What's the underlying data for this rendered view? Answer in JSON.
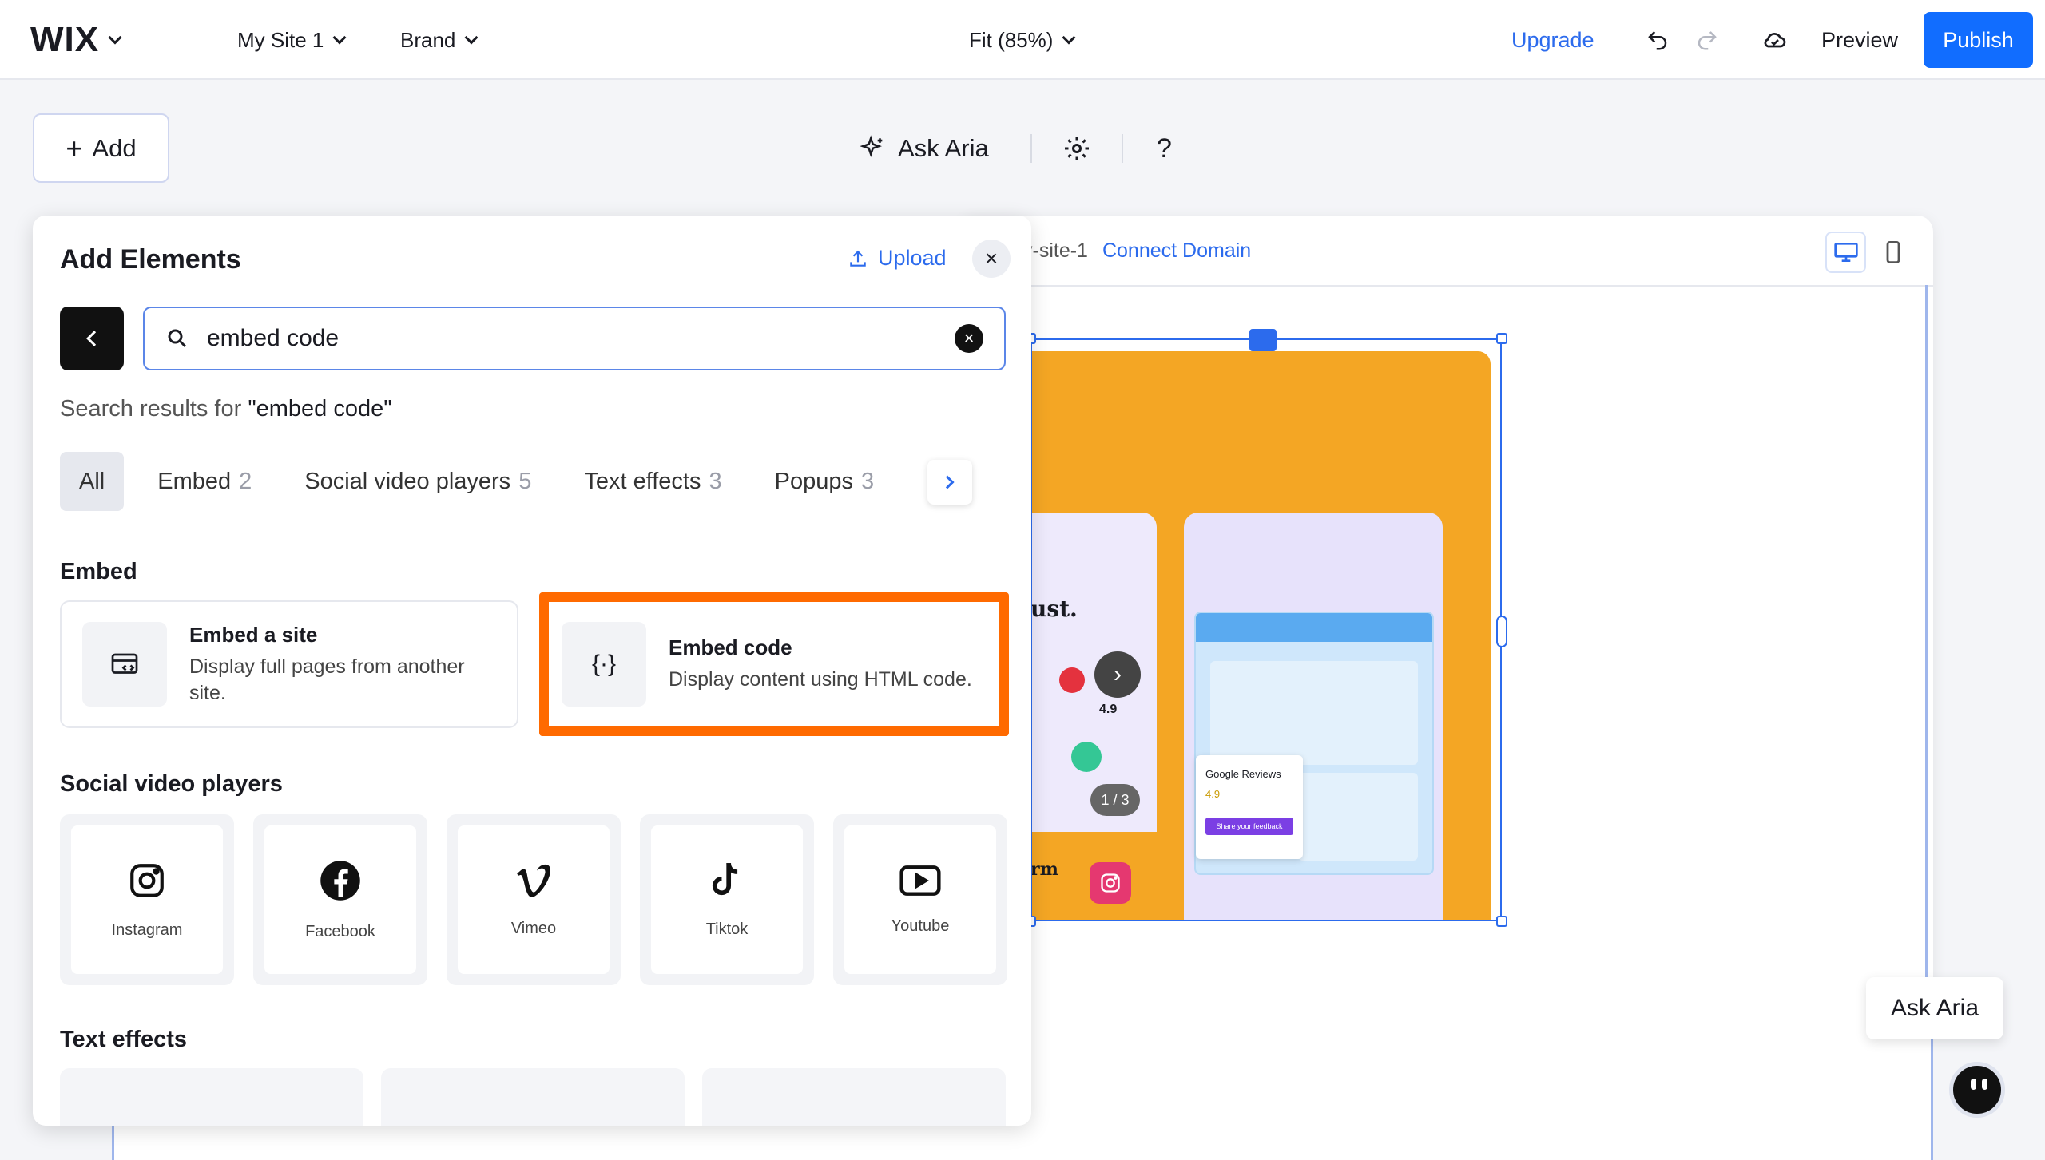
{
  "topbar": {
    "logo": "WIX",
    "site_menu": "My Site 1",
    "brand_menu": "Brand",
    "zoom": "Fit (85%)",
    "upgrade": "Upgrade",
    "preview": "Preview",
    "publish": "Publish"
  },
  "toolbar": {
    "add": "Add",
    "ask_aria": "Ask Aria",
    "help": "?"
  },
  "canvas": {
    "url_fragment": "y-site-1",
    "connect_domain": "Connect Domain",
    "review_heading": "ust.",
    "review_sub": "rm",
    "rating": "4.9",
    "pager": "1 / 3",
    "google_reviews": "Google Reviews",
    "google_rating": "4.9",
    "feedback_cta": "Share your feedback"
  },
  "panel": {
    "title": "Add Elements",
    "upload": "Upload",
    "search_value": "embed code",
    "results_prefix": "Search results for ",
    "results_query": "\"embed code\"",
    "filters": [
      {
        "label": "All",
        "count": ""
      },
      {
        "label": "Embed",
        "count": "2"
      },
      {
        "label": "Social video players",
        "count": "5"
      },
      {
        "label": "Text effects",
        "count": "3"
      },
      {
        "label": "Popups",
        "count": "3"
      }
    ],
    "embed_section": "Embed",
    "embed_items": [
      {
        "title": "Embed a site",
        "desc": "Display full pages from another site."
      },
      {
        "title": "Embed code",
        "desc": "Display content using HTML code."
      }
    ],
    "social_section": "Social video players",
    "social_items": [
      "Instagram",
      "Facebook",
      "Vimeo",
      "Tiktok",
      "Youtube"
    ],
    "text_effects_section": "Text effects"
  },
  "aria_bubble": "Ask Aria",
  "colors": {
    "accent": "#116dff",
    "highlight": "#ff6a00",
    "canvas_orange": "#f4a624"
  }
}
